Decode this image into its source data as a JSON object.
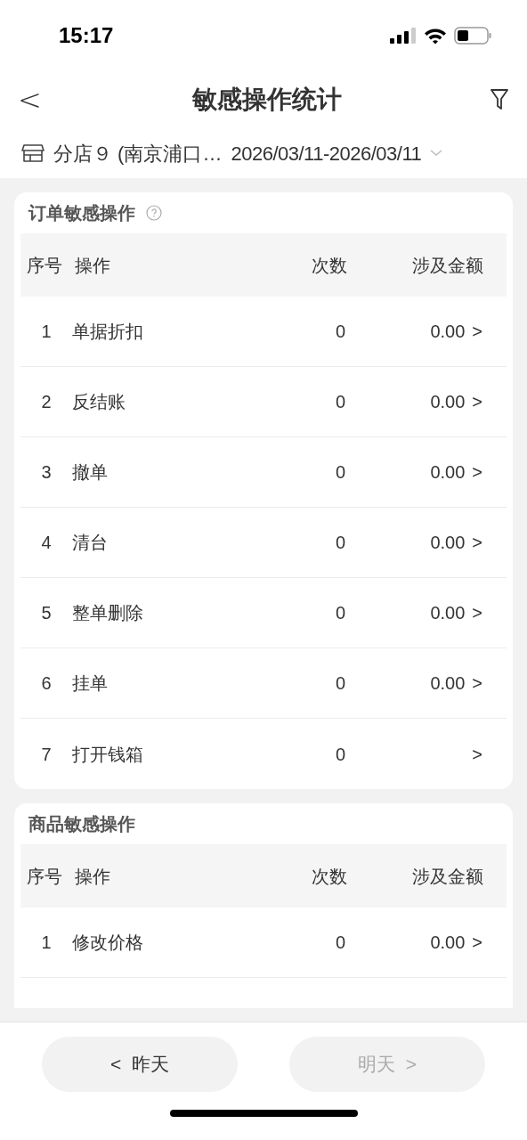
{
  "status_bar": {
    "time": "15:17"
  },
  "header": {
    "back": "<",
    "title": "敏感操作统计"
  },
  "filter": {
    "store": "分店９ (南京浦口…",
    "date_range": "2026/03/11-2026/03/11"
  },
  "sections": [
    {
      "title": "订单敏感操作",
      "help": true,
      "columns": [
        "序号",
        "操作",
        "次数",
        "涉及金额"
      ],
      "rows": [
        {
          "index": "1",
          "operation": "单据折扣",
          "count": "0",
          "amount": "0.00",
          "chevron": ">"
        },
        {
          "index": "2",
          "operation": "反结账",
          "count": "0",
          "amount": "0.00",
          "chevron": ">"
        },
        {
          "index": "3",
          "operation": "撤单",
          "count": "0",
          "amount": "0.00",
          "chevron": ">"
        },
        {
          "index": "4",
          "operation": "清台",
          "count": "0",
          "amount": "0.00",
          "chevron": ">"
        },
        {
          "index": "5",
          "operation": "整单删除",
          "count": "0",
          "amount": "0.00",
          "chevron": ">"
        },
        {
          "index": "6",
          "operation": "挂单",
          "count": "0",
          "amount": "0.00",
          "chevron": ">"
        },
        {
          "index": "7",
          "operation": "打开钱箱",
          "count": "0",
          "chevron": ">"
        }
      ]
    },
    {
      "title": "商品敏感操作",
      "help": false,
      "columns": [
        "序号",
        "操作",
        "次数",
        "涉及金额"
      ],
      "rows": [
        {
          "index": "1",
          "operation": "修改价格",
          "count": "0",
          "amount": "0.00",
          "chevron": ">"
        }
      ]
    }
  ],
  "footer": [
    {
      "label": "<  昨天",
      "disabled": false
    },
    {
      "label": "明天  >",
      "disabled": true
    }
  ]
}
